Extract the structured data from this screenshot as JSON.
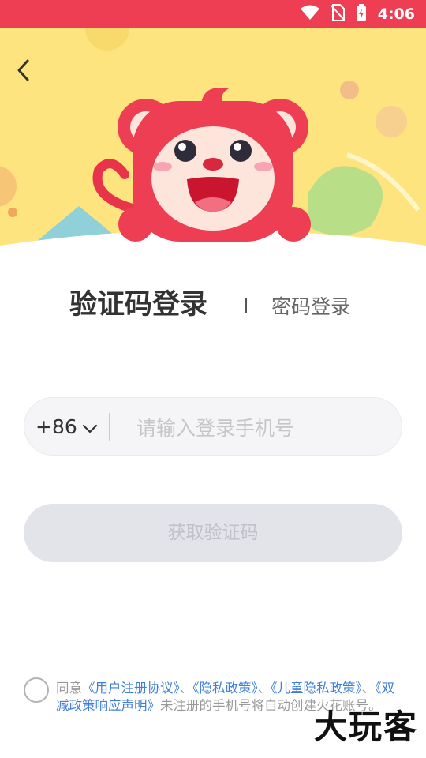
{
  "status_bar": {
    "time": "4:06"
  },
  "header": {
    "back_icon": "chevron-left-icon",
    "mascot": "red-monkey-mascot"
  },
  "tabs": {
    "active_label": "验证码登录",
    "inactive_label": "密码登录"
  },
  "phone": {
    "country_code": "+86",
    "placeholder": "请输入登录手机号",
    "value": ""
  },
  "get_code_button": {
    "label": "获取验证码"
  },
  "agreement": {
    "prefix": "同意",
    "user_agreement": "《用户注册协议》",
    "sep1": "、",
    "privacy_policy": "《隐私政策》",
    "sep2": "、",
    "child_privacy": "《儿童隐私政策》",
    "sep3": "、",
    "double_reduction": "《双减政策响应声明》",
    "suffix": "未注册的手机号将自动创建火花账号。"
  },
  "watermark": {
    "text": "大玩客"
  },
  "colors": {
    "brand_red": "#ee3e54",
    "header_yellow": "#fde47e",
    "link_blue": "#3f7ed7"
  }
}
